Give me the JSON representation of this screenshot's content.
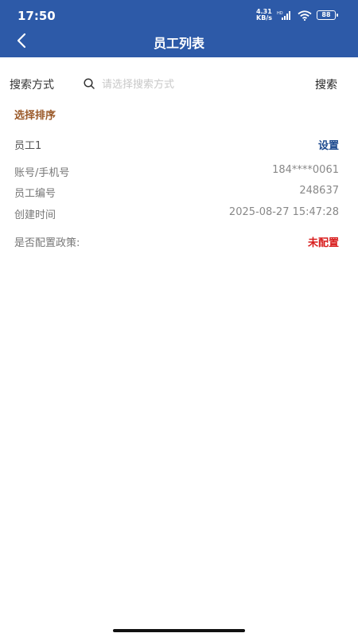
{
  "status_bar": {
    "time": "17:50",
    "net_speed_value": "4.31",
    "net_speed_unit": "KB/s",
    "battery": "88"
  },
  "header": {
    "title": "员工列表",
    "back_icon": "chevron-left-icon"
  },
  "search": {
    "label": "搜索方式",
    "placeholder": "请选择搜索方式",
    "button": "搜索"
  },
  "sort": {
    "label": "选择排序"
  },
  "employee": {
    "name": "员工1",
    "setting": "设置",
    "fields": [
      {
        "label": "账号/手机号",
        "value": "184****0061"
      },
      {
        "label": "员工编号",
        "value": "248637"
      },
      {
        "label": "创建时间",
        "value": "2025-08-27 15:47:28"
      }
    ],
    "policy_label": "是否配置政策:",
    "policy_status": "未配置"
  },
  "colors": {
    "header_bg": "#2d5aa8",
    "sort_label": "#9b5a2a",
    "link": "#1d4a8f",
    "status_red": "#d81c1c"
  }
}
